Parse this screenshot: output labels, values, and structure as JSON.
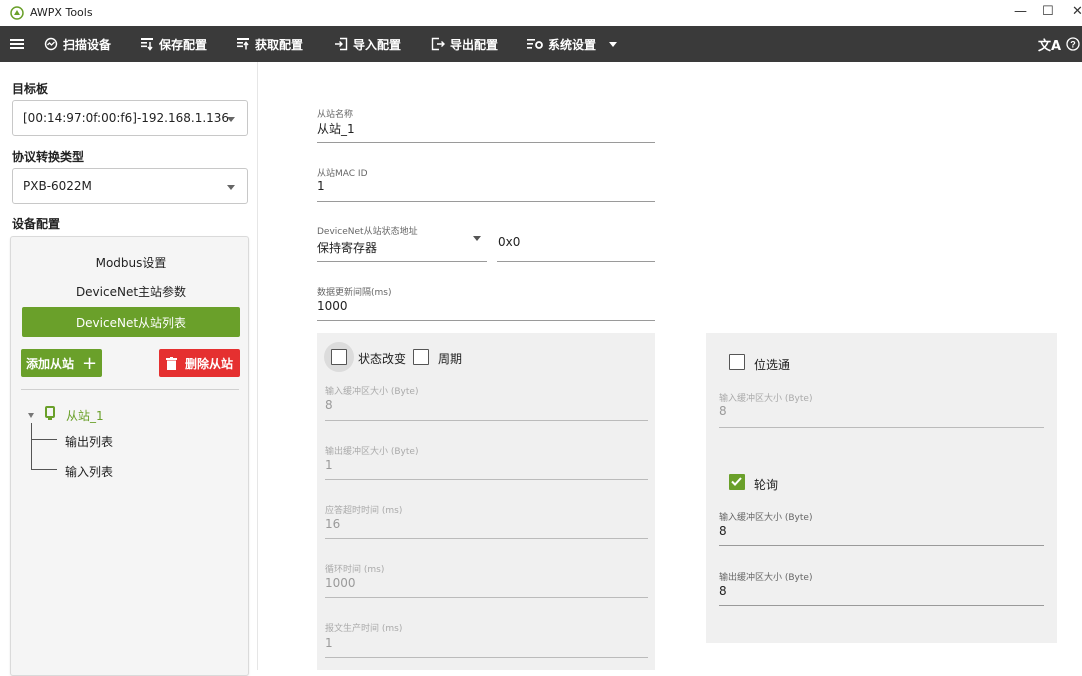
{
  "window": {
    "title": "AWPX Tools",
    "minimize": "—",
    "maximize": "☐",
    "close": "✕"
  },
  "toolbar": {
    "menu_icon": "hamburger-icon",
    "items": [
      {
        "label": "扫描设备",
        "icon": "scan-icon"
      },
      {
        "label": "保存配置",
        "icon": "save-config-icon"
      },
      {
        "label": "获取配置",
        "icon": "fetch-config-icon"
      },
      {
        "label": "导入配置",
        "icon": "import-icon"
      },
      {
        "label": "导出配置",
        "icon": "export-icon"
      },
      {
        "label": "系统设置",
        "icon": "settings-icon"
      }
    ],
    "translate_icon": "translate-icon",
    "help_icon": "help-icon"
  },
  "sidebar": {
    "target_label": "目标板",
    "target_value": "[00:14:97:0f:00:f6]-192.168.1.136",
    "protocol_label": "协议转换类型",
    "protocol_value": "PXB-6022M",
    "device_config_label": "设备配置",
    "menu": [
      {
        "label": "Modbus设置",
        "active": false
      },
      {
        "label": "DeviceNet主站参数",
        "active": false
      },
      {
        "label": "DeviceNet从站列表",
        "active": true
      }
    ],
    "add_button": "添加从站",
    "add_symbol": "+",
    "delete_button": "删除从站",
    "tree": {
      "root": "从站_1",
      "children": [
        "输出列表",
        "输入列表"
      ]
    }
  },
  "form": {
    "slave_name_label": "从站名称",
    "slave_name_value": "从站_1",
    "mac_label": "从站MAC ID",
    "mac_value": "1",
    "status_addr_label": "DeviceNet从站状态地址",
    "status_addr_value": "保持寄存器",
    "status_addr_hex": "0x0",
    "update_interval_label": "数据更新间隔(ms)",
    "update_interval_value": "1000"
  },
  "card_left": {
    "state_change_label": "状态改变",
    "state_change_checked": false,
    "cyclic_label": "周期",
    "cyclic_checked": false,
    "fields": [
      {
        "label": "输入缓冲区大小 (Byte)",
        "value": "8"
      },
      {
        "label": "输出缓冲区大小 (Byte)",
        "value": "1"
      },
      {
        "label": "应答超时时间 (ms)",
        "value": "16"
      },
      {
        "label": "循环时间 (ms)",
        "value": "1000"
      },
      {
        "label": "报文生产时间 (ms)",
        "value": "1"
      }
    ]
  },
  "card_right": {
    "bit_strobe_label": "位选通",
    "bit_strobe_checked": false,
    "bit_input_label": "输入缓冲区大小 (Byte)",
    "bit_input_value": "8",
    "polling_label": "轮询",
    "polling_checked": true,
    "poll_input_label": "输入缓冲区大小 (Byte)",
    "poll_input_value": "8",
    "poll_output_label": "输出缓冲区大小 (Byte)",
    "poll_output_value": "8"
  },
  "colors": {
    "accent": "#6aa02a",
    "danger": "#e53030",
    "toolbar": "#3a3a3a"
  }
}
